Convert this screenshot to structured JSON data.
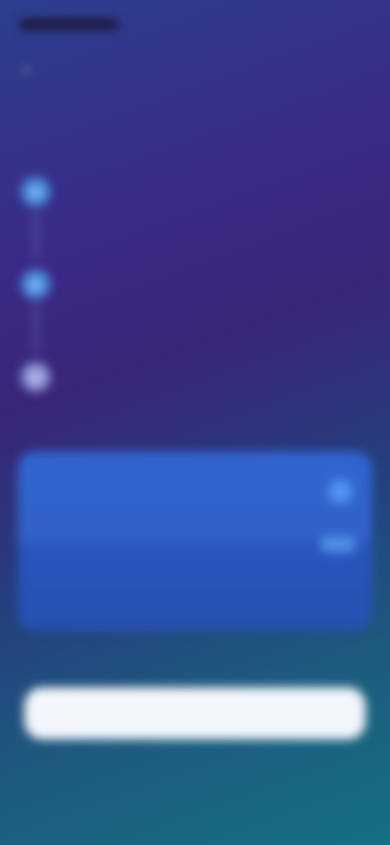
{
  "status_bar": {
    "time": "",
    "icons": ""
  },
  "header": {
    "back_icon": "chevron-left-icon",
    "headline": ""
  },
  "steps": [
    {
      "icon": "lock-icon",
      "title": "",
      "description": ""
    },
    {
      "icon": "bell-icon",
      "title": "",
      "description": ""
    },
    {
      "icon": "star-icon",
      "title": "",
      "description": ""
    }
  ],
  "plans": {
    "yearly": {
      "name": "",
      "price": "",
      "badge": ""
    },
    "monthly": {
      "name": "",
      "price": ""
    }
  },
  "trial_note": "",
  "cta": {
    "label": ""
  },
  "fineprint": "",
  "colors": {
    "accent": "#4a8fe0",
    "plan_card": "#2c5bc8",
    "cta_bg": "#f3f6fb"
  }
}
